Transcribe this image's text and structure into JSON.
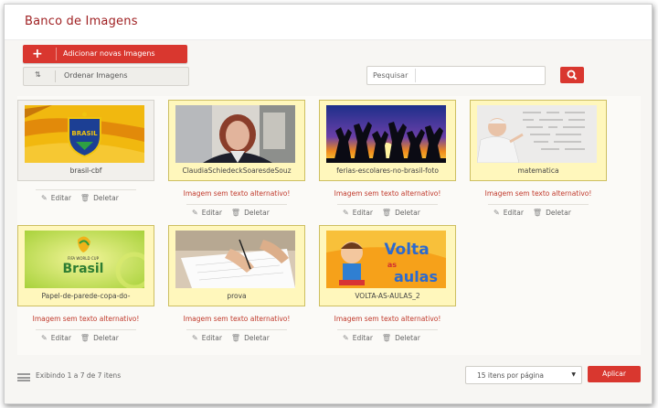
{
  "header": {
    "title": "Banco de Imagens"
  },
  "toolbar": {
    "add_label": "Adicionar novas Imagens",
    "order_label": "Ordenar Imagens",
    "search_label": "Pesquisar",
    "accent": "#d9372f"
  },
  "images": [
    {
      "caption": "brasil-cbf",
      "warning": "",
      "highlight": false,
      "edit": "Editar",
      "delete": "Deletar"
    },
    {
      "caption": "ClaudiaSchiedeckSoaresdeSouz",
      "warning": "Imagem sem texto alternativo!",
      "highlight": true,
      "edit": "Editar",
      "delete": "Deletar"
    },
    {
      "caption": "ferias-escolares-no-brasil-foto",
      "warning": "Imagem sem texto alternativo!",
      "highlight": true,
      "edit": "Editar",
      "delete": "Deletar"
    },
    {
      "caption": "matematica",
      "warning": "Imagem sem texto alternativo!",
      "highlight": true,
      "edit": "Editar",
      "delete": "Deletar"
    },
    {
      "caption": "Papel-de-parede-copa-do-",
      "warning": "Imagem sem texto alternativo!",
      "highlight": true,
      "edit": "Editar",
      "delete": "Deletar"
    },
    {
      "caption": "prova",
      "warning": "Imagem sem texto alternativo!",
      "highlight": true,
      "edit": "Editar",
      "delete": "Deletar"
    },
    {
      "caption": "VOLTA-AS-AULAS_2",
      "warning": "Imagem sem texto alternativo!",
      "highlight": true,
      "edit": "Editar",
      "delete": "Deletar"
    }
  ],
  "thumb_text": {
    "brasil_logo": "BRASIL",
    "copa_text": "Brasil",
    "copa_small": "FIFA WORLD CUP",
    "volta_1": "Volta",
    "volta_2": "as",
    "volta_3": "aulas"
  },
  "footer": {
    "summary": "Exibindo 1 a 7 de 7 itens",
    "per_page": "15 itens por página",
    "apply_label": "Aplicar"
  }
}
